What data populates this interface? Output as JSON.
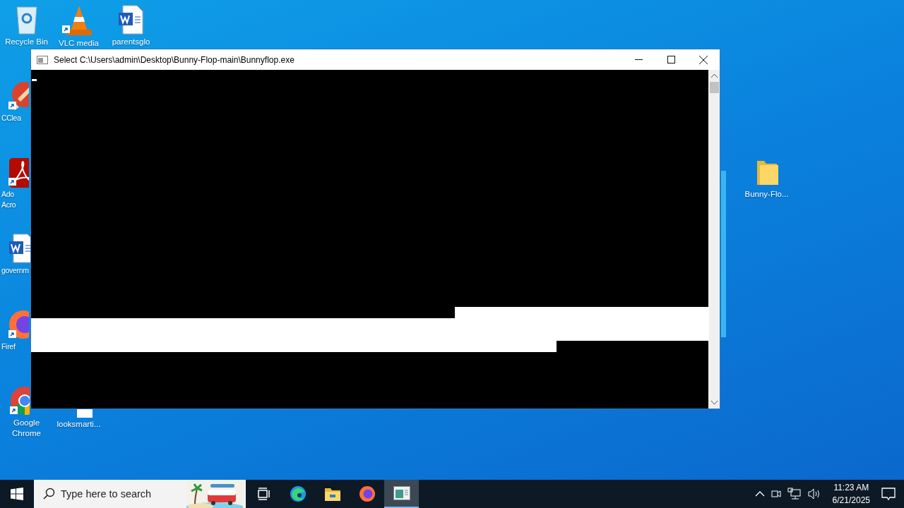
{
  "desktop": {
    "icons": [
      {
        "label": "Recycle Bin",
        "kind": "recycle",
        "shortcut": false
      },
      {
        "label": "VLC media",
        "kind": "vlc",
        "shortcut": true
      },
      {
        "label": "parentsglo",
        "kind": "word",
        "shortcut": false
      },
      {
        "label": "CClea",
        "kind": "ccleaner",
        "shortcut": true
      },
      {
        "label": "Ado\nAcro",
        "kind": "acrobat",
        "shortcut": true
      },
      {
        "label": "governm",
        "kind": "word",
        "shortcut": false
      },
      {
        "label": "Firef",
        "kind": "firefox",
        "shortcut": true
      },
      {
        "label": "Google\nChrome",
        "kind": "chrome",
        "shortcut": true
      },
      {
        "label": "looksmarti...",
        "kind": "document",
        "shortcut": false
      },
      {
        "label": "Bunny-Flo...",
        "kind": "folder",
        "shortcut": false
      }
    ]
  },
  "window": {
    "title": "Select C:\\Users\\admin\\Desktop\\Bunny-Flop-main\\Bunnyflop.exe",
    "cursor": true,
    "selection": true
  },
  "taskbar": {
    "search": {
      "placeholder": "Type here to search"
    },
    "apps": [
      {
        "kind": "taskview",
        "selected": false
      },
      {
        "kind": "edge",
        "selected": false
      },
      {
        "kind": "explorer",
        "selected": false
      },
      {
        "kind": "firefox",
        "selected": false
      },
      {
        "kind": "console",
        "selected": true
      }
    ],
    "tray": {
      "time": "11:23 AM",
      "date": "6/21/2025"
    }
  }
}
